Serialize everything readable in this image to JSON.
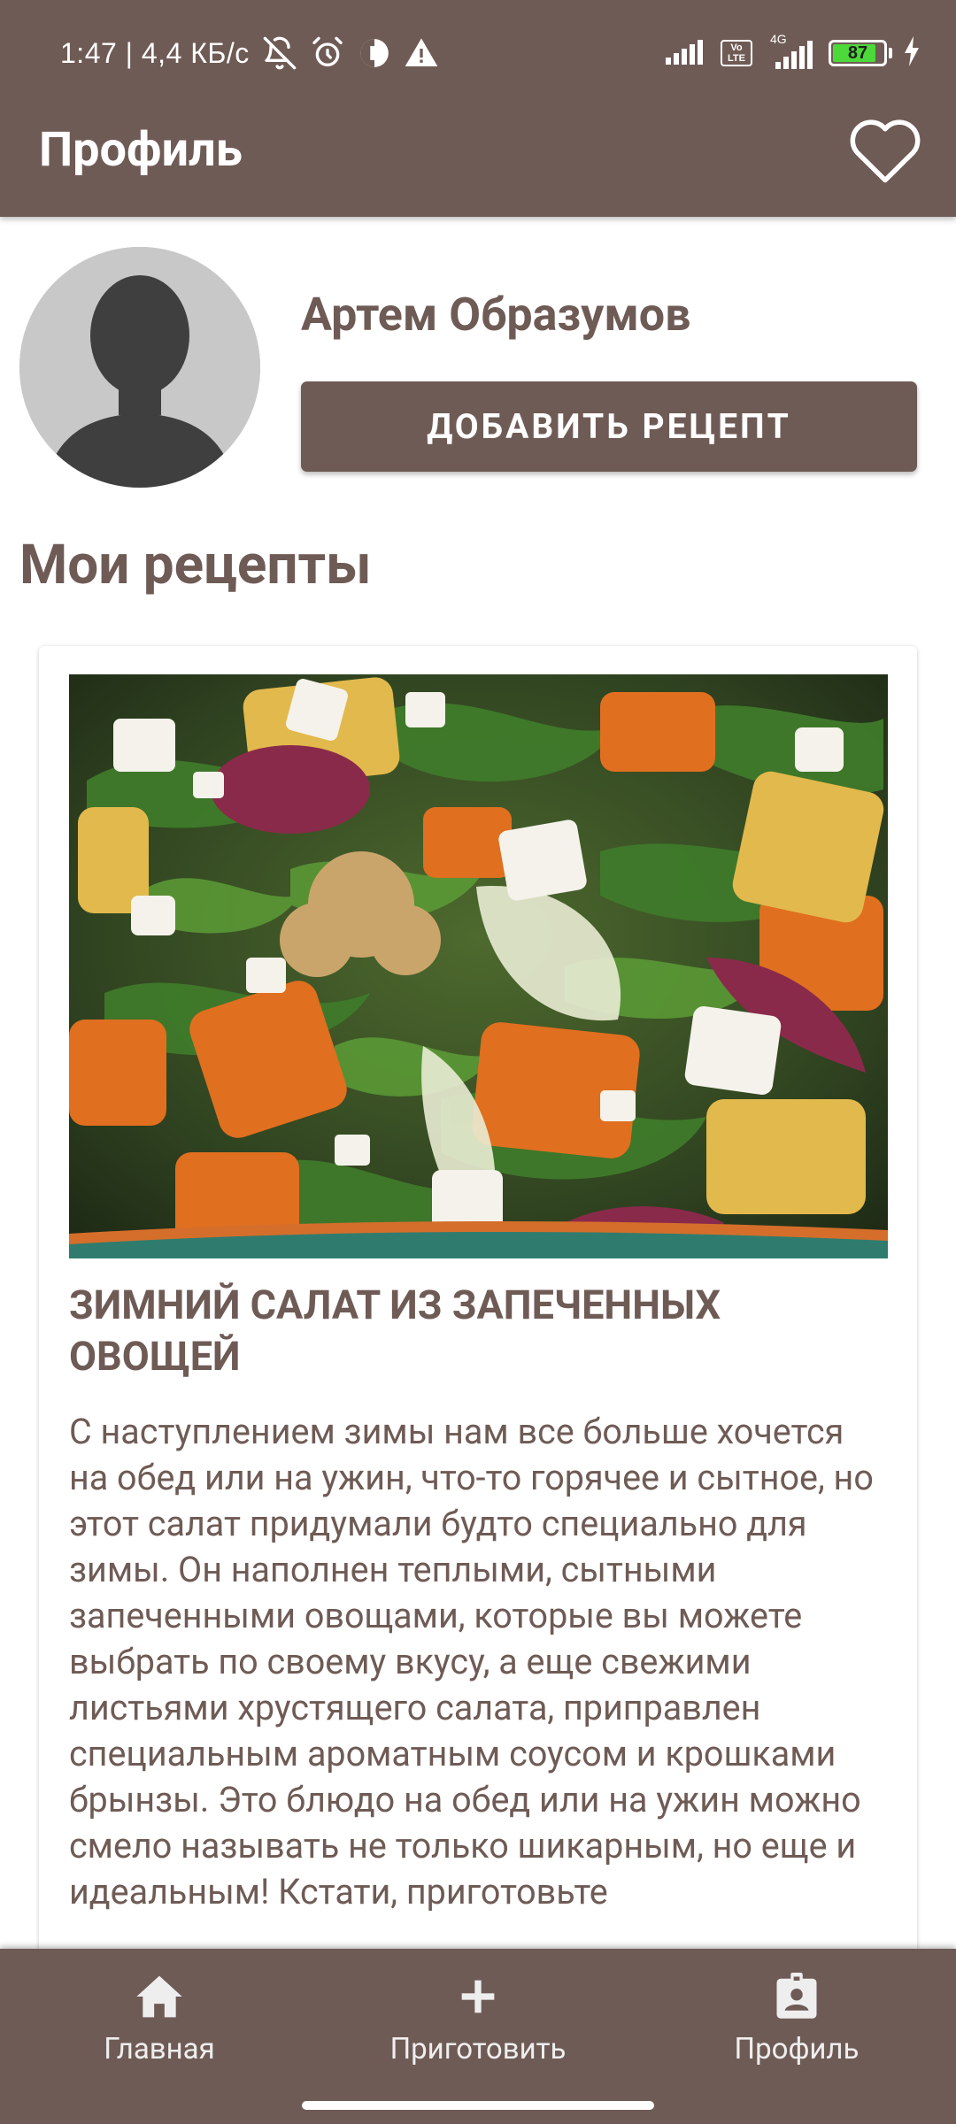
{
  "status_bar": {
    "time_speed": "1:47 | 4,4 КБ/с",
    "battery_level": "87",
    "battery_percent": 87,
    "network_label": "4G",
    "volte_label_1": "Vo",
    "volte_label_2": "LTE"
  },
  "app_bar": {
    "title": "Профиль",
    "favorite_icon": "heart-outline-icon"
  },
  "profile": {
    "user_name": "Артем Образумов",
    "add_recipe_label": "ДОБАВИТЬ РЕЦЕПТ",
    "avatar_icon": "person-silhouette-icon"
  },
  "my_recipes": {
    "section_title": "Мои рецепты",
    "recipes": [
      {
        "title": "Зимний салат из запеченных овощей",
        "description": "С наступлением зимы нам все больше хочется на обед или на ужин, что-то горячее и сытное, но этот салат придумали будто специально для зимы. Он наполнен теплыми, сытными запеченными овощами, которые вы можете выбрать по своему вкусу, а еще свежими листьями хрустящего салата, приправлен специальным ароматным соусом и крошками брынзы. Это блюдо на обед или на ужин можно смело называть не только шикарным, но еще и идеальным! Кстати, приготовьте"
      }
    ]
  },
  "bottom_nav": {
    "items": [
      {
        "label": "Главная",
        "icon": "home-icon"
      },
      {
        "label": "Приготовить",
        "icon": "plus-icon"
      },
      {
        "label": "Профиль",
        "icon": "profile-badge-icon"
      }
    ]
  },
  "colors": {
    "primary": "#6f5b55",
    "background": "#ffffff",
    "battery": "#4cd93a"
  }
}
